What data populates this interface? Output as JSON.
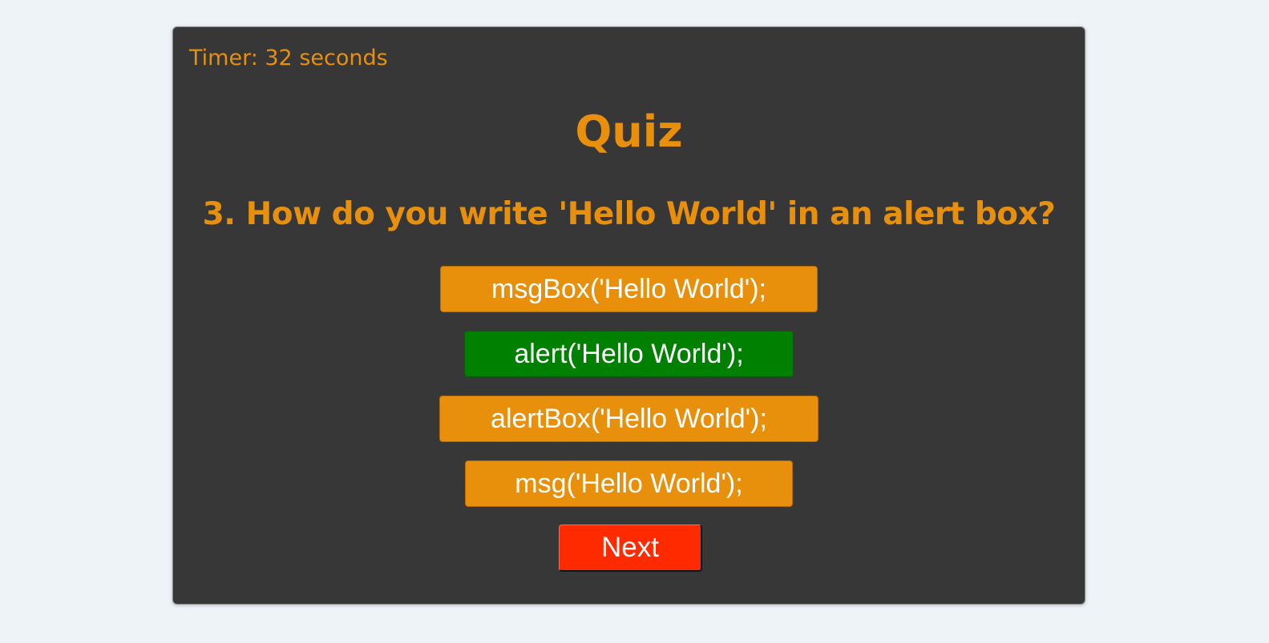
{
  "timer": {
    "text": "Timer: 32 seconds"
  },
  "quiz": {
    "title": "Quiz",
    "question": "3. How do you write 'Hello World' in an alert box?",
    "answers": [
      {
        "label": "msgBox('Hello World');",
        "state": "default"
      },
      {
        "label": "alert('Hello World');",
        "state": "correct"
      },
      {
        "label": "alertBox('Hello World');",
        "state": "default"
      },
      {
        "label": "msg('Hello World');",
        "state": "default"
      }
    ],
    "next_label": "Next"
  },
  "colors": {
    "page_background": "#eef3f8",
    "card_background": "#373737",
    "accent": "#e8900c",
    "correct": "#008000",
    "next_button": "#ff2a00",
    "button_text": "#ffffff"
  }
}
